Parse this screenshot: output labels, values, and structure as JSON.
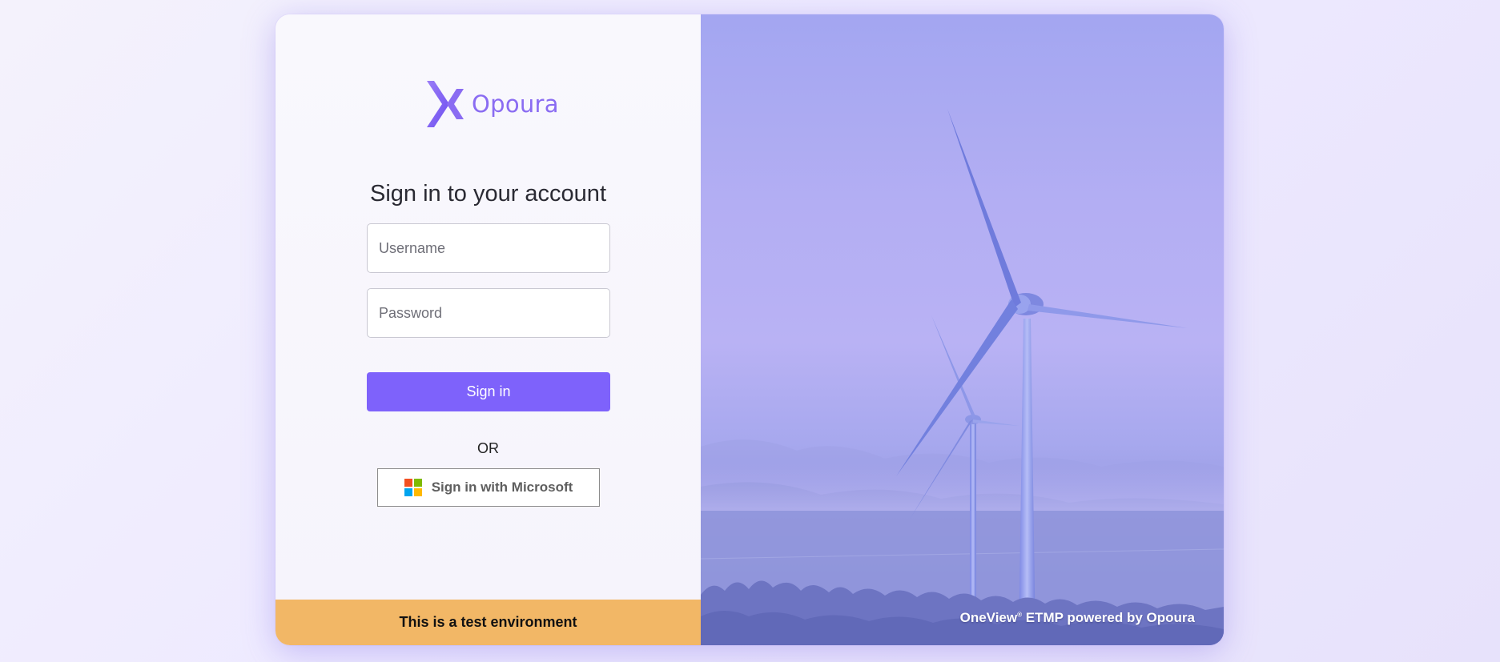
{
  "brand": {
    "name": "Opoura",
    "colors": {
      "accent": "#7e62fb",
      "logo": "#8a6cf2",
      "banner": "#f2b766"
    }
  },
  "login": {
    "title": "Sign in to your account",
    "username_placeholder": "Username",
    "password_placeholder": "Password",
    "signin_label": "Sign in",
    "or_label": "OR",
    "microsoft_label": "Sign in with Microsoft",
    "microsoft_icon": "microsoft-logo-icon"
  },
  "banner": {
    "text": "This is a test environment"
  },
  "hero": {
    "image_subject": "wind-turbines",
    "footer_product": "OneView",
    "footer_reg": "®",
    "footer_rest": " ETMP powered by Opoura"
  }
}
